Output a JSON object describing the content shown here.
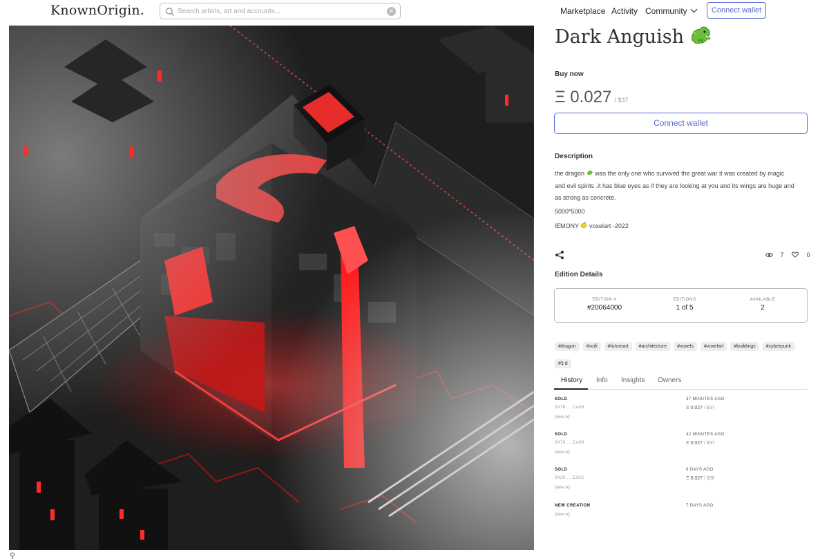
{
  "header": {
    "logo": "KnownOrigin.",
    "search_placeholder": "Search artists, art and accounts...",
    "nav": {
      "marketplace": "Marketplace",
      "activity": "Activity",
      "community": "Community"
    },
    "connect_wallet": "Connect wallet"
  },
  "artwork": {
    "title": "Dark Anguish"
  },
  "buy": {
    "label": "Buy now",
    "price": "Ξ 0.027",
    "usd": "/ $37",
    "connect_wallet": "Connect wallet"
  },
  "description": {
    "label": "Description",
    "line1_a": "the dragon",
    "line1_b": "was the only one who survived the great war it was created by magic",
    "line2": "and evil spirits .it has blue eyes as if they are looking at you and its wings are huge and",
    "line3": "as strong as concrete.",
    "size": "5000*5000",
    "signature_a": "lEMONY",
    "signature_b": "voxelart -2022"
  },
  "stats": {
    "views": "7",
    "likes": "0"
  },
  "edition": {
    "label": "Edition Details",
    "number_key": "EDITION #",
    "number_val": "#20064000",
    "editions_key": "EDITIONS",
    "editions_val": "1 of 5",
    "available_key": "AVAILABLE",
    "available_val": "2"
  },
  "tags": [
    "#dragon",
    "#scifi",
    "#futureart",
    "#architecture",
    "#voxels",
    "#voxelart",
    "#buildings",
    "#cyberpunk",
    "#3 d"
  ],
  "tabs": [
    "History",
    "Info",
    "Insights",
    "Owners"
  ],
  "history": [
    {
      "event": "SOLD",
      "address": "0X76 ... CA68",
      "link": "[view tx]",
      "time": "37 MINUTES AGO",
      "price": "Ξ 0.027",
      "usd": "/ $37"
    },
    {
      "event": "SOLD",
      "address": "0X76 ... CA68",
      "link": "[view tx]",
      "time": "42 MINUTES AGO",
      "price": "Ξ 0.027",
      "usd": "/ $37"
    },
    {
      "event": "SOLD",
      "address": "0X20 ... E26C",
      "link": "[view tx]",
      "time": "6 DAYS AGO",
      "price": "Ξ 0.027",
      "usd": "/ $36"
    },
    {
      "event": "NEW CREATION",
      "address": "",
      "link": "[view tx]",
      "time": "7 DAYS AGO",
      "price": "",
      "usd": ""
    }
  ],
  "colors": {
    "accent": "#5469d4",
    "lava": "#ff2a2a"
  }
}
